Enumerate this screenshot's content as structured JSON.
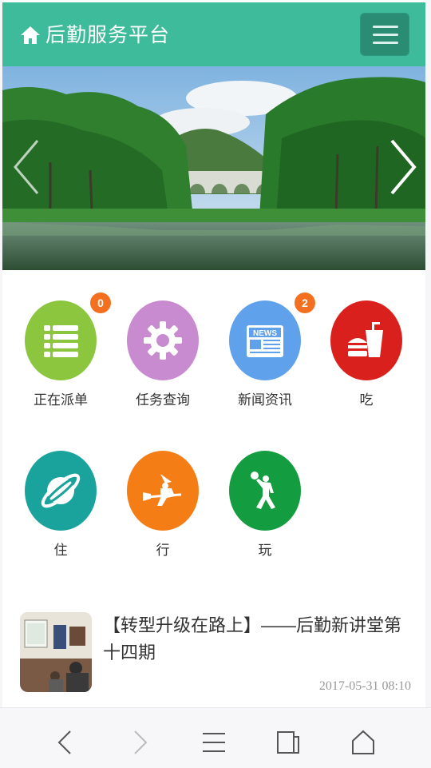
{
  "header": {
    "title": "后勤服务平台",
    "home_icon": "home-icon",
    "menu_icon": "hamburger-menu-icon"
  },
  "banner": {
    "prev_icon": "chevron-left-icon",
    "next_icon": "chevron-right-icon"
  },
  "grid": [
    {
      "label": "正在派单",
      "icon": "list-icon",
      "color": "#8cc63f",
      "badge": "0"
    },
    {
      "label": "任务查询",
      "icon": "gear-icon",
      "color": "#c98bd0",
      "badge": null
    },
    {
      "label": "新闻资讯",
      "icon": "news-icon",
      "color": "#5fa1ea",
      "badge": "2"
    },
    {
      "label": "吃",
      "icon": "fast-food-icon",
      "color": "#d9201c",
      "badge": null
    },
    {
      "label": "住",
      "icon": "planet-icon",
      "color": "#1aa39c",
      "badge": null
    },
    {
      "label": "行",
      "icon": "witch-broom-icon",
      "color": "#f47d15",
      "badge": null
    },
    {
      "label": "玩",
      "icon": "basketball-player-icon",
      "color": "#149c41",
      "badge": null
    }
  ],
  "news": {
    "title": "【转型升级在路上】——后勤新讲堂第十四期",
    "date": "2017-05-31 08:10"
  },
  "bottom_nav": [
    "back-icon",
    "forward-icon",
    "menu-icon",
    "tabs-icon",
    "home-icon"
  ]
}
